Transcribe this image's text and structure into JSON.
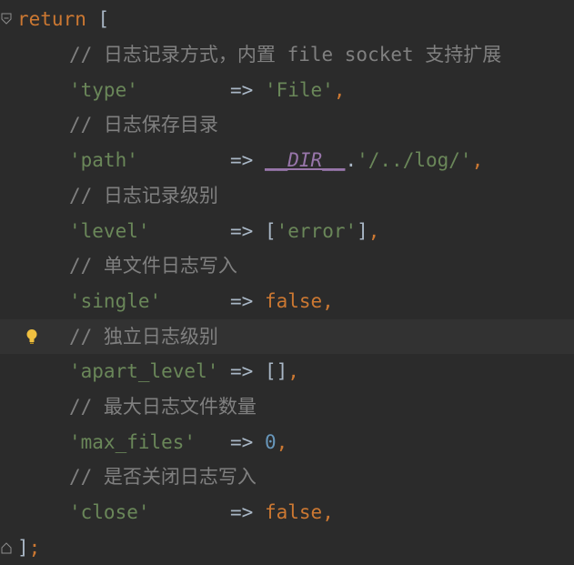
{
  "colors": {
    "background": "#2b2b2b",
    "current_line": "#323232",
    "keyword": "#cc7832",
    "string": "#6a8759",
    "comment": "#808080",
    "number": "#6897bb",
    "constant": "#9876aa",
    "default_text": "#a9b7c6",
    "bulb": "#f0c040"
  },
  "code": {
    "open": {
      "keyword": "return",
      "bracket": " ["
    },
    "entries": [
      {
        "comment": "// 日志记录方式，内置 file socket 支持扩展",
        "key": "'type'",
        "pad": "        ",
        "arrow": "=> ",
        "value_str": "'File'",
        "tail": ","
      },
      {
        "comment": "// 日志保存目录",
        "key": "'path'",
        "pad": "        ",
        "arrow": "=> ",
        "value_const": "__DIR__",
        "value_dot": ".",
        "value_str": "'/../log/'",
        "tail": ","
      },
      {
        "comment": "// 日志记录级别",
        "key": "'level'",
        "pad": "       ",
        "arrow": "=> ",
        "value_open": "[",
        "value_str": "'error'",
        "value_close": "]",
        "tail": ","
      },
      {
        "comment": "// 单文件日志写入",
        "key": "'single'",
        "pad": "      ",
        "arrow": "=> ",
        "value_kw": "false",
        "tail": ","
      },
      {
        "comment": "// 独立日志级别",
        "key": "'apart_level'",
        "pad": " ",
        "arrow": "=> ",
        "value_plain": "[]",
        "tail": ","
      },
      {
        "comment": "// 最大日志文件数量",
        "key": "'max_files'",
        "pad": "   ",
        "arrow": "=> ",
        "value_num": "0",
        "tail": ","
      },
      {
        "comment": "// 是否关闭日志写入",
        "key": "'close'",
        "pad": "       ",
        "arrow": "=> ",
        "value_kw": "false",
        "tail": ","
      }
    ],
    "close": {
      "bracket": "]",
      "semicolon": ";"
    }
  },
  "gutter": {
    "fold_open_icon": "fold-open-icon",
    "fold_close_icon": "fold-close-icon",
    "intention_icon": "lightbulb-icon"
  }
}
